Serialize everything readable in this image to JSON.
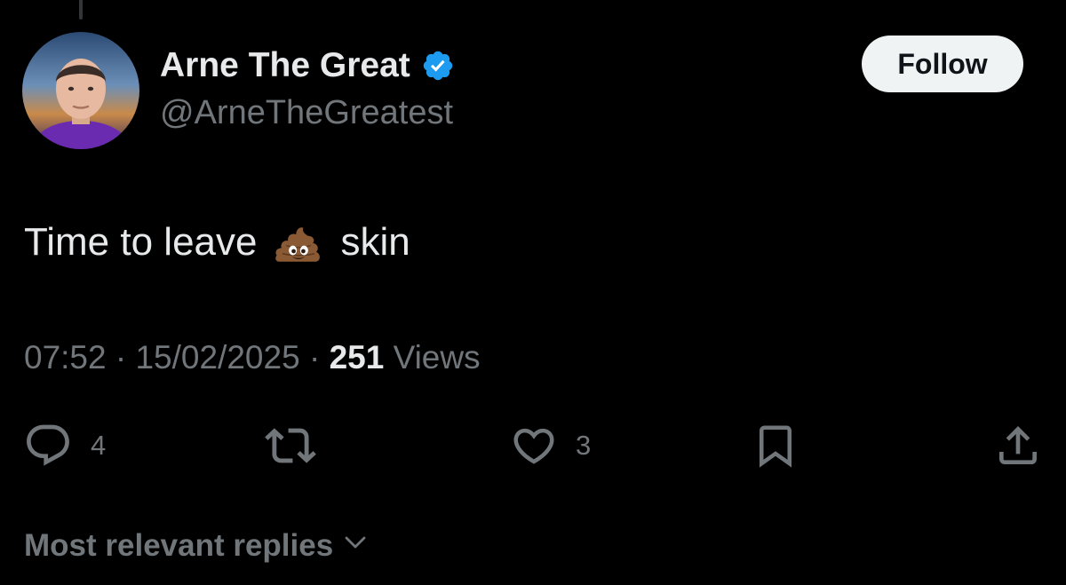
{
  "author": {
    "display_name": "Arne The Great",
    "handle": "@ArneTheGreatest",
    "verified": true,
    "verified_color": "#1d9bf0"
  },
  "follow_button": {
    "label": "Follow"
  },
  "tweet": {
    "text_before": "Time to leave",
    "emoji": "pile-of-poo",
    "text_after": "skin"
  },
  "meta": {
    "time": "07:52",
    "separator": "·",
    "date": "15/02/2025",
    "views_count": "251",
    "views_label": "Views"
  },
  "actions": {
    "reply": {
      "icon": "reply-icon",
      "count": "4"
    },
    "repost": {
      "icon": "repost-icon",
      "count": ""
    },
    "like": {
      "icon": "heart-icon",
      "count": "3"
    },
    "bookmark": {
      "icon": "bookmark-icon"
    },
    "share": {
      "icon": "share-icon"
    }
  },
  "replies_sort": {
    "label": "Most relevant replies",
    "icon": "chevron-down-icon"
  },
  "colors": {
    "background": "#000000",
    "primary_text": "#e7e9ea",
    "secondary_text": "#71767b",
    "follow_bg": "#eff3f4"
  }
}
